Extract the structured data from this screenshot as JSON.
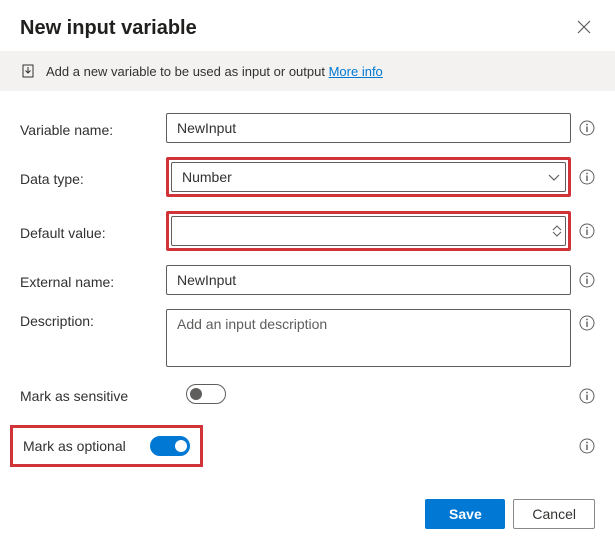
{
  "header": {
    "title": "New input variable"
  },
  "banner": {
    "text": "Add a new variable to be used as input or output",
    "link": "More info"
  },
  "fields": {
    "variable_name": {
      "label": "Variable name:",
      "value": "NewInput"
    },
    "data_type": {
      "label": "Data type:",
      "value": "Number"
    },
    "default_value": {
      "label": "Default value:",
      "value": ""
    },
    "external_name": {
      "label": "External name:",
      "value": "NewInput"
    },
    "description": {
      "label": "Description:",
      "placeholder": "Add an input description"
    },
    "mark_sensitive": {
      "label": "Mark as sensitive",
      "on": false
    },
    "mark_optional": {
      "label": "Mark as optional",
      "on": true
    }
  },
  "footer": {
    "save": "Save",
    "cancel": "Cancel"
  },
  "colors": {
    "accent": "#0078d4",
    "danger": "#d13438"
  }
}
